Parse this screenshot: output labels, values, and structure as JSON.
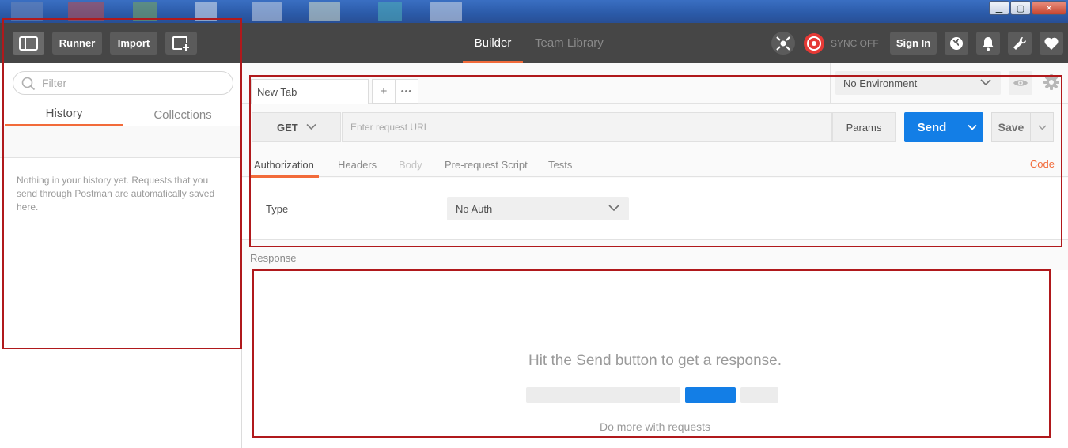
{
  "window": {
    "controls": {
      "minimize": "▁",
      "maximize": "▢",
      "close": "✕"
    }
  },
  "header": {
    "runner_label": "Runner",
    "import_label": "Import",
    "tabs": [
      {
        "label": "Builder",
        "active": true
      },
      {
        "label": "Team Library",
        "active": false
      }
    ],
    "sync_label": "SYNC OFF",
    "sign_in_label": "Sign In",
    "icons": [
      "sidebar-toggle-icon",
      "new-window-icon",
      "interceptor-icon",
      "sync-icon",
      "globe-icon",
      "bell-icon",
      "wrench-icon",
      "heart-icon"
    ]
  },
  "sidebar": {
    "filter_placeholder": "Filter",
    "tabs": [
      {
        "label": "History",
        "active": true
      },
      {
        "label": "Collections",
        "active": false
      }
    ],
    "empty_message": "Nothing in your history yet. Requests that you send through Postman are automatically saved here."
  },
  "request": {
    "tab_label": "New Tab",
    "add_tab": "+",
    "more_tabs": "•••",
    "environment": "No Environment",
    "method": "GET",
    "url_placeholder": "Enter request URL",
    "params_label": "Params",
    "send_label": "Send",
    "save_label": "Save",
    "subtabs": [
      {
        "label": "Authorization",
        "state": "active"
      },
      {
        "label": "Headers",
        "state": "normal"
      },
      {
        "label": "Body",
        "state": "disabled"
      },
      {
        "label": "Pre-request Script",
        "state": "normal"
      },
      {
        "label": "Tests",
        "state": "normal"
      }
    ],
    "code_label": "Code",
    "auth": {
      "type_label": "Type",
      "type_value": "No Auth"
    }
  },
  "response": {
    "header_label": "Response",
    "empty_title": "Hit the Send button to get a response.",
    "more_label": "Do more with requests"
  },
  "colors": {
    "accent_orange": "#f26b3a",
    "send_blue": "#137ee6",
    "header_bg": "#464646",
    "annotation_red": "#b0191c"
  }
}
